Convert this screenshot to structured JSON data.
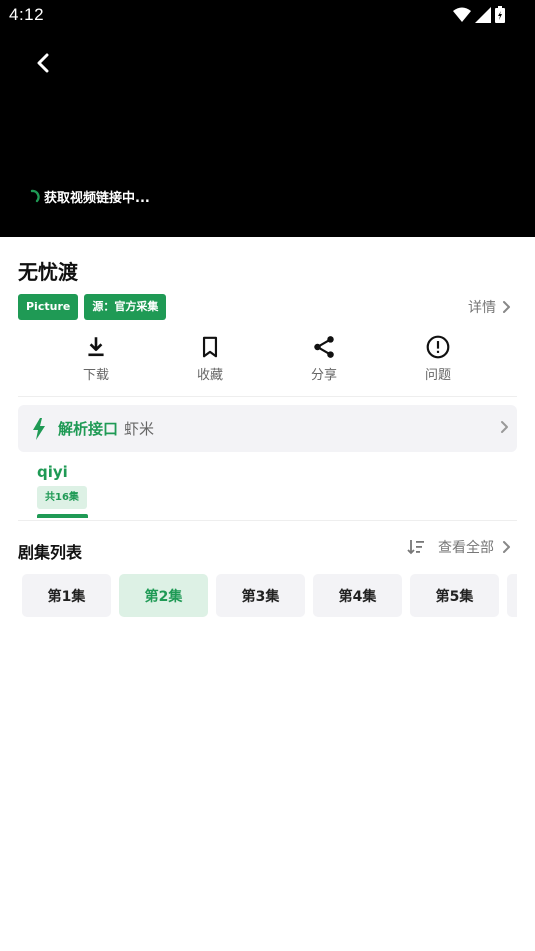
{
  "status_bar": {
    "time": "4:12"
  },
  "player": {
    "loading_text": "获取视频链接中..."
  },
  "video": {
    "title": "无忧渡",
    "tags": [
      "Picture",
      "源：官方采集"
    ],
    "detail_label": "详情"
  },
  "actions": [
    {
      "label": "下载",
      "icon": "download-icon"
    },
    {
      "label": "收藏",
      "icon": "bookmark-icon"
    },
    {
      "label": "分享",
      "icon": "share-icon"
    },
    {
      "label": "问题",
      "icon": "alert-icon"
    }
  ],
  "parse": {
    "label": "解析接口",
    "value": "虾米"
  },
  "source": {
    "name": "qiyi",
    "count": "共16集"
  },
  "episodes": {
    "title": "剧集列表",
    "view_all": "查看全部",
    "items": [
      "第1集",
      "第2集",
      "第3集",
      "第4集",
      "第5集"
    ],
    "selected": "第2集"
  },
  "colors": {
    "accent": "#1f9a55",
    "accent_light": "#ddf1e5",
    "player_bg": "#000000"
  }
}
